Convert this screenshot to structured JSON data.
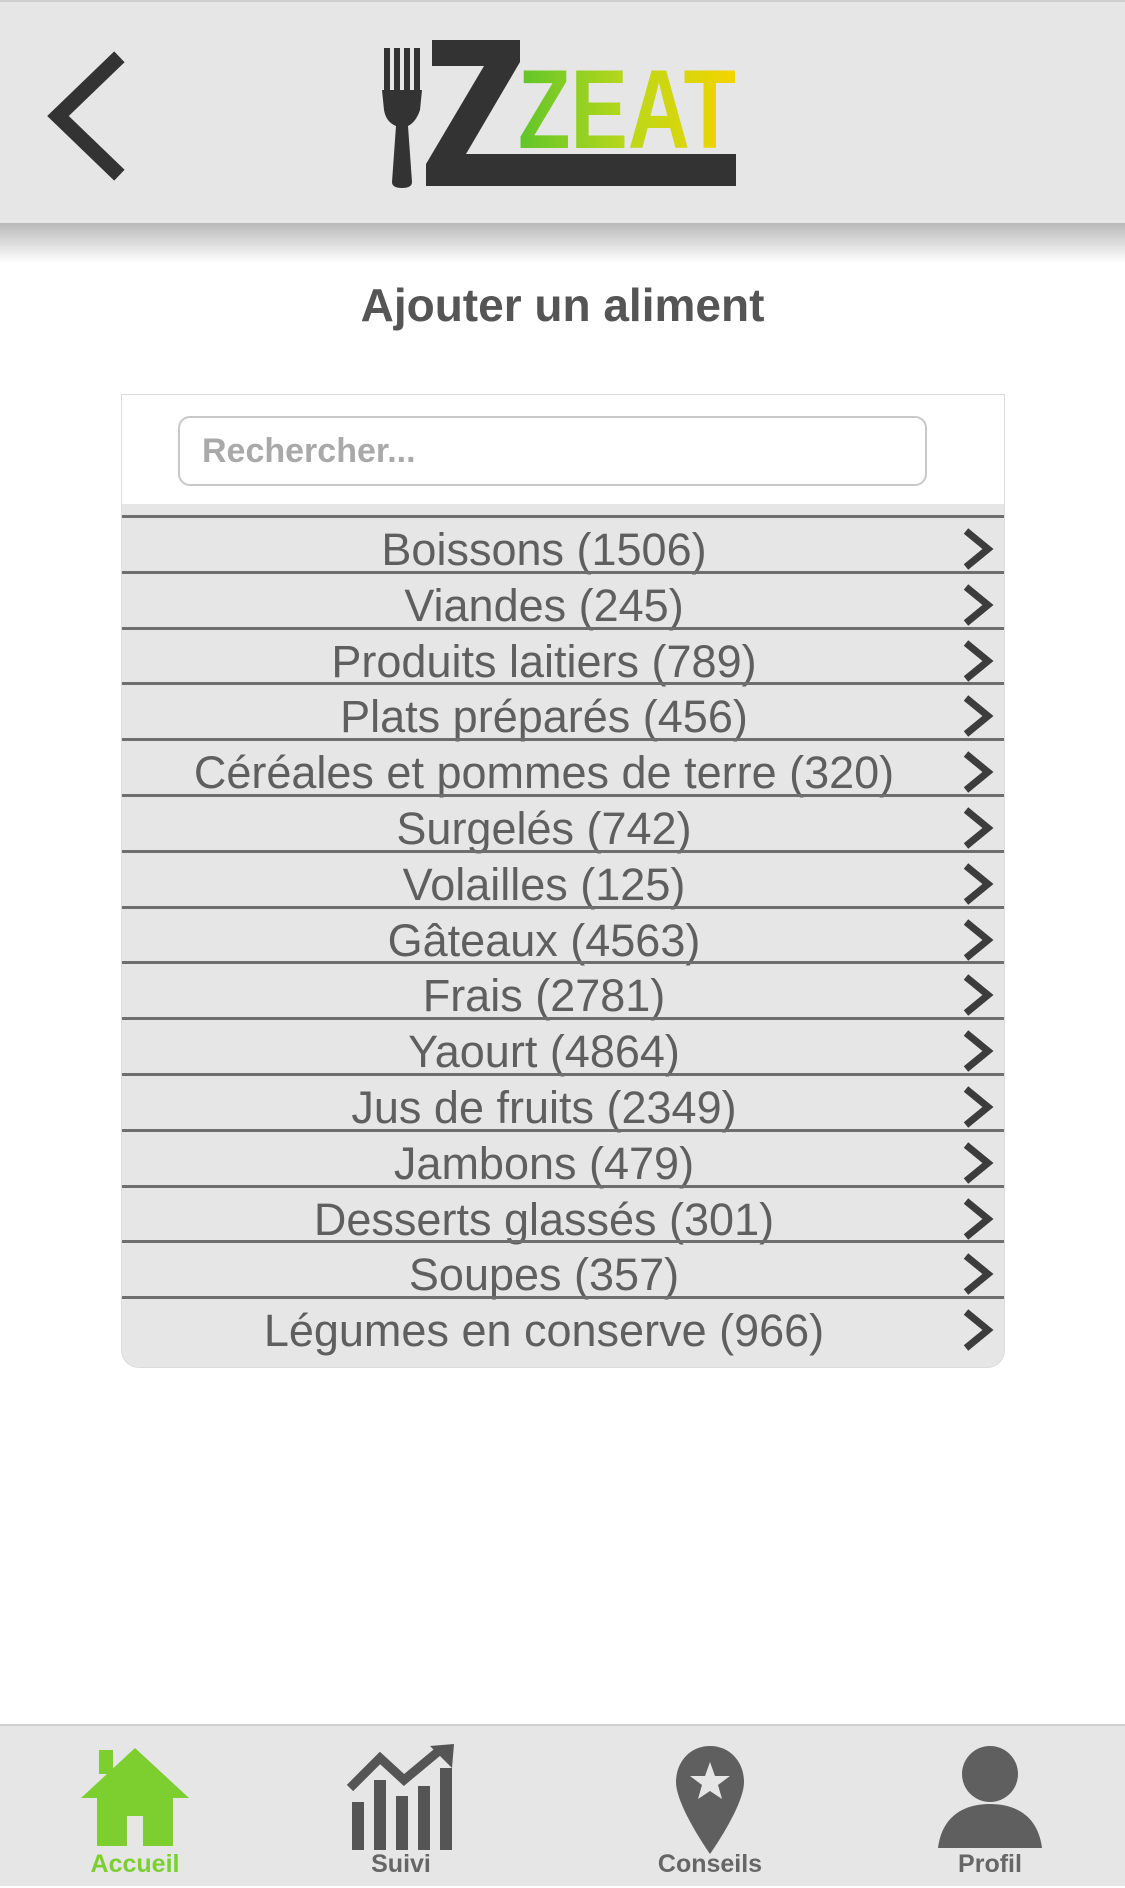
{
  "header": {
    "logo_text": "ZEAT",
    "back_icon": "chevron-left-icon"
  },
  "page_title": "Ajouter un aliment",
  "search": {
    "placeholder": "Rechercher...",
    "value": ""
  },
  "categories": [
    {
      "label": "Boissons (1506)"
    },
    {
      "label": "Viandes (245)"
    },
    {
      "label": "Produits laitiers (789)"
    },
    {
      "label": "Plats préparés (456)"
    },
    {
      "label": "Céréales et pommes de terre (320)"
    },
    {
      "label": "Surgelés (742)"
    },
    {
      "label": "Volailles (125)"
    },
    {
      "label": "Gâteaux (4563)"
    },
    {
      "label": "Frais (2781)"
    },
    {
      "label": "Yaourt (4864)"
    },
    {
      "label": "Jus de fruits (2349)"
    },
    {
      "label": "Jambons (479)"
    },
    {
      "label": "Desserts glassés (301)"
    },
    {
      "label": "Soupes (357)"
    },
    {
      "label": "Légumes en conserve (966)"
    }
  ],
  "tabbar": {
    "items": [
      {
        "label": "Accueil",
        "icon": "home-icon",
        "active": true
      },
      {
        "label": "Suivi",
        "icon": "chart-icon",
        "active": false
      },
      {
        "label": "Conseils",
        "icon": "map-pin-star-icon",
        "active": false
      },
      {
        "label": "Profil",
        "icon": "user-icon",
        "active": false
      }
    ]
  },
  "colors": {
    "accent": "#7ccf2f",
    "header_bg": "#e6e6e6",
    "list_bg": "#e6e6e6",
    "text": "#5f5f5f",
    "logo_dark": "#333333",
    "logo_green": "#5fc52a",
    "logo_yellow": "#f2d400"
  }
}
